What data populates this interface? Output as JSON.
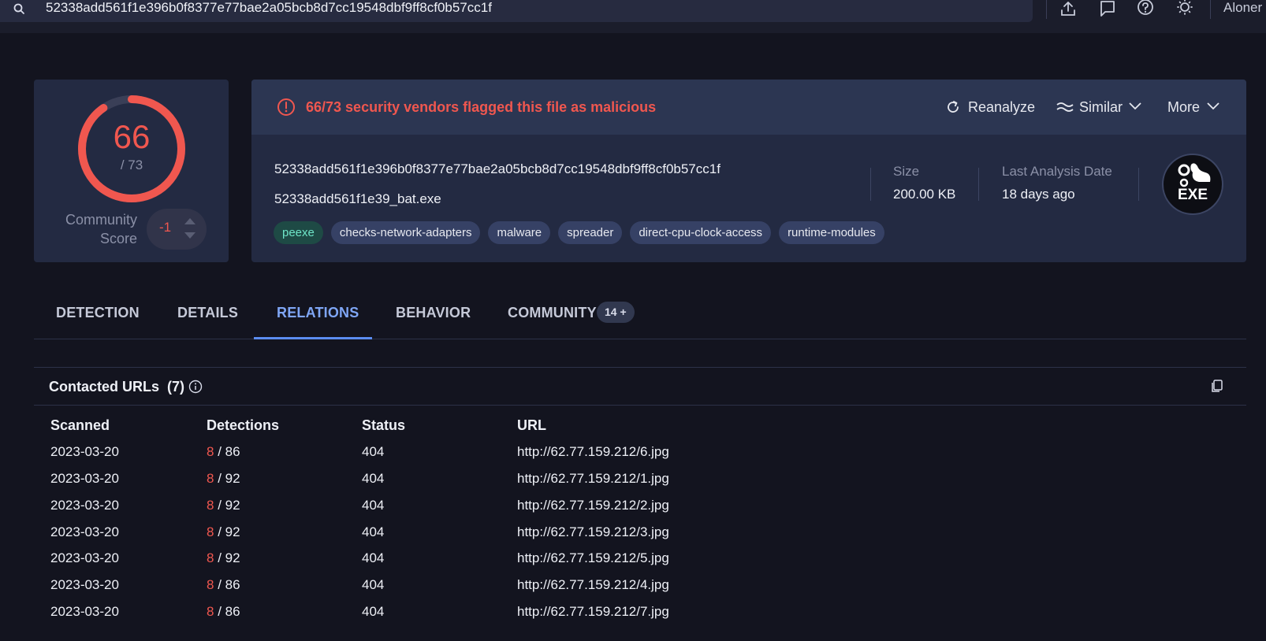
{
  "search": {
    "query": "52338add561f1e396b0f8377e77bae2a05bcb8d7cc19548dbf9ff8cf0b57cc1f"
  },
  "user": {
    "name": "Aloner"
  },
  "score": {
    "detected": "66",
    "total": "/ 73",
    "detected_fraction": 0.904,
    "community_label_1": "Community",
    "community_label_2": "Score",
    "community_value": "-1"
  },
  "alert": {
    "text": "66/73 security vendors flagged this file as malicious",
    "color": "#f0574f"
  },
  "actions": {
    "reanalyze": "Reanalyze",
    "similar": "Similar",
    "more": "More"
  },
  "file": {
    "hash": "52338add561f1e396b0f8377e77bae2a05bcb8d7cc19548dbf9ff8cf0b57cc1f",
    "name": "52338add561f1e39_bat.exe",
    "size_label": "Size",
    "size_value": "200.00 KB",
    "date_label": "Last Analysis Date",
    "date_value": "18 days ago",
    "type_badge": "EXE"
  },
  "tags": [
    "peexe",
    "checks-network-adapters",
    "malware",
    "spreader",
    "direct-cpu-clock-access",
    "runtime-modules"
  ],
  "tabs": {
    "detection": "DETECTION",
    "details": "DETAILS",
    "relations": "RELATIONS",
    "behavior": "BEHAVIOR",
    "community": "COMMUNITY",
    "community_badge": "14 +"
  },
  "contacted_urls": {
    "title": "Contacted URLs",
    "count": "(7)",
    "columns": [
      "Scanned",
      "Detections",
      "Status",
      "URL"
    ],
    "rows": [
      {
        "scanned": "2023-03-20",
        "det": "8",
        "det_total": "/ 86",
        "status": "404",
        "url": "http://62.77.159.212/6.jpg"
      },
      {
        "scanned": "2023-03-20",
        "det": "8",
        "det_total": "/ 92",
        "status": "404",
        "url": "http://62.77.159.212/1.jpg"
      },
      {
        "scanned": "2023-03-20",
        "det": "8",
        "det_total": "/ 92",
        "status": "404",
        "url": "http://62.77.159.212/2.jpg"
      },
      {
        "scanned": "2023-03-20",
        "det": "8",
        "det_total": "/ 92",
        "status": "404",
        "url": "http://62.77.159.212/3.jpg"
      },
      {
        "scanned": "2023-03-20",
        "det": "8",
        "det_total": "/ 92",
        "status": "404",
        "url": "http://62.77.159.212/5.jpg"
      },
      {
        "scanned": "2023-03-20",
        "det": "8",
        "det_total": "/ 86",
        "status": "404",
        "url": "http://62.77.159.212/4.jpg"
      },
      {
        "scanned": "2023-03-20",
        "det": "8",
        "det_total": "/ 86",
        "status": "404",
        "url": "http://62.77.159.212/7.jpg"
      }
    ]
  }
}
